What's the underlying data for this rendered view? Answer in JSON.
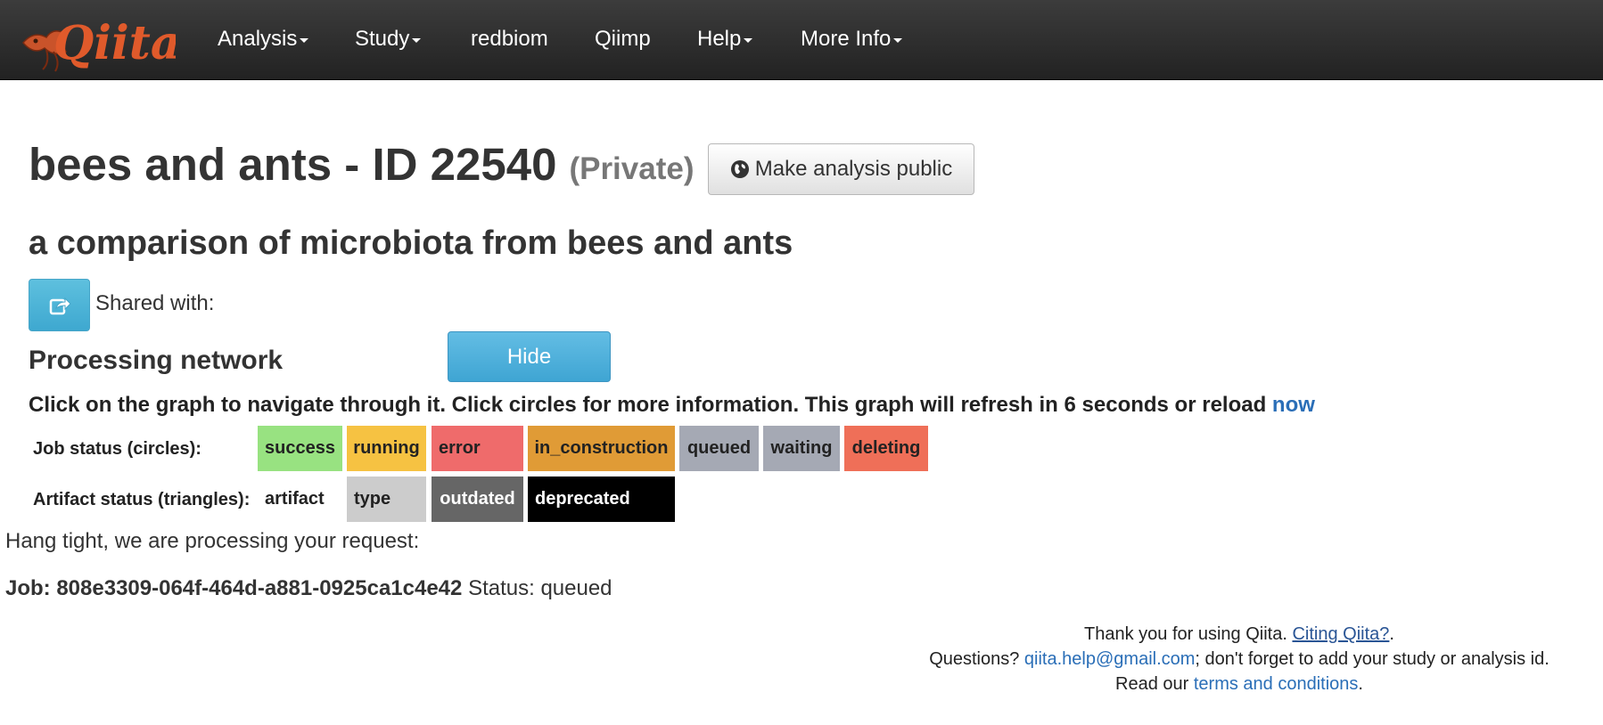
{
  "nav": {
    "brand": "Qiita",
    "items": [
      {
        "label": "Analysis",
        "dropdown": true
      },
      {
        "label": "Study",
        "dropdown": true
      },
      {
        "label": "redbiom",
        "dropdown": false
      },
      {
        "label": "Qiimp",
        "dropdown": false
      },
      {
        "label": "Help",
        "dropdown": true
      },
      {
        "label": "More Info",
        "dropdown": true
      }
    ]
  },
  "analysis": {
    "title": "bees and ants - ID 22540",
    "visibility": "(Private)",
    "make_public_label": "Make analysis public",
    "description": "a comparison of microbiota from bees and ants",
    "shared_with_label": "Shared with:"
  },
  "processing": {
    "heading": "Processing network",
    "hide_label": "Hide",
    "instructions": "Click on the graph to navigate through it. Click circles for more information. This graph will refresh in 6 seconds or reload",
    "reload_link": "now"
  },
  "legend": {
    "job_label": "Job status (circles):",
    "job_statuses": [
      {
        "label": "success",
        "color": "#98e281"
      },
      {
        "label": "running",
        "color": "#f6c242"
      },
      {
        "label": "error",
        "color": "#ef6b6b"
      },
      {
        "label": "in_construction",
        "color": "#e09b36"
      },
      {
        "label": "queued",
        "color": "#a5a9b4"
      },
      {
        "label": "waiting",
        "color": "#a5a9b4"
      },
      {
        "label": "deleting",
        "color": "#ef6f58"
      }
    ],
    "artifact_label": "Artifact status (triangles):",
    "artifact_statuses": [
      {
        "label": "artifact",
        "color": "#ffffff"
      },
      {
        "label": "type",
        "color": "#cccccc"
      },
      {
        "label": "outdated",
        "color": "#666666"
      },
      {
        "label": "deprecated",
        "color": "#000000"
      }
    ]
  },
  "job": {
    "waiting_message": "Hang tight, we are processing your request:",
    "prefix": "Job: 808e3309-064f-464d-a881-0925ca1c4e42",
    "status": "Status: queued"
  },
  "footer": {
    "thanks": "Thank you for using Qiita.",
    "citing_link": "Citing Qiita?",
    "questions": "Questions?",
    "email": "qiita.help@gmail.com",
    "email_suffix": "; don't forget to add your study or analysis id.",
    "read_our": "Read our",
    "terms_link": "terms and conditions"
  },
  "colors": {
    "navbar": "#2b2b2b",
    "brand": "#e05a2b",
    "link": "#2a6eb7",
    "primary_button": "#4aaed8"
  }
}
